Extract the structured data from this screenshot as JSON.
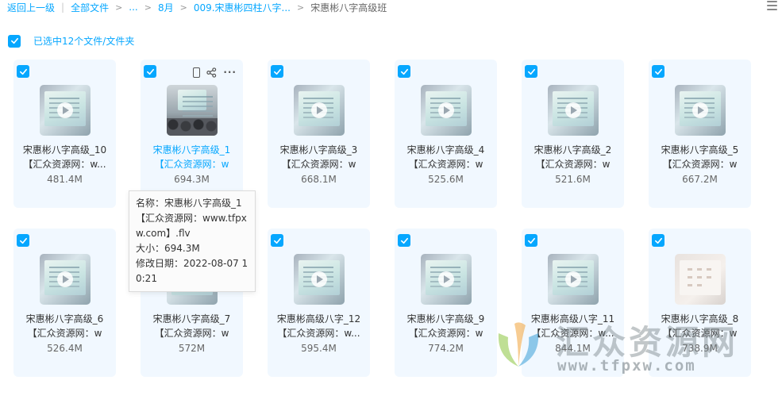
{
  "breadcrumb": {
    "back": "返回上一级",
    "all_files": "全部文件",
    "ellipsis": "...",
    "month": "8月",
    "folder": "009.宋惠彬四柱八字...",
    "current": "宋惠彬八字高级班"
  },
  "selection": {
    "label": "已选中12个文件/文件夹"
  },
  "accent_color": "#06a7ff",
  "files": [
    {
      "name1": "宋惠彬八字高级_10",
      "name2": "【汇众资源网：w...",
      "size": "481.4M",
      "thumb": "video-thumb"
    },
    {
      "name1": "宋惠彬八字高级_1",
      "name2": "【汇众资源网：w",
      "size": "694.3M",
      "thumb": "video-thumb-crowd"
    },
    {
      "name1": "宋惠彬八字高级_3",
      "name2": "【汇众资源网：w",
      "size": "668.1M",
      "thumb": "video-thumb"
    },
    {
      "name1": "宋惠彬八字高级_4",
      "name2": "【汇众资源网：w",
      "size": "525.6M",
      "thumb": "video-thumb"
    },
    {
      "name1": "宋惠彬八字高级_2",
      "name2": "【汇众资源网：w",
      "size": "521.6M",
      "thumb": "video-thumb"
    },
    {
      "name1": "宋惠彬八字高级_5",
      "name2": "【汇众资源网：w",
      "size": "667.2M",
      "thumb": "video-thumb"
    },
    {
      "name1": "宋惠彬八字高级_6",
      "name2": "【汇众资源网：w",
      "size": "526.4M",
      "thumb": "video-thumb"
    },
    {
      "name1": "宋惠彬八字高级_7",
      "name2": "【汇众资源网：w",
      "size": "572M",
      "thumb": "video-thumb"
    },
    {
      "name1": "宋惠彬高级八字_12",
      "name2": "【汇众资源网：w...",
      "size": "595.4M",
      "thumb": "video-thumb"
    },
    {
      "name1": "宋惠彬八字高级_9",
      "name2": "【汇众资源网：w",
      "size": "774.2M",
      "thumb": "video-thumb"
    },
    {
      "name1": "宋惠彬高级八字_11",
      "name2": "【汇众资源网：w...",
      "size": "844.1M",
      "thumb": "video-thumb"
    },
    {
      "name1": "宋惠彬八字高级_8",
      "name2": "【汇众资源网：w",
      "size": "738.9M",
      "thumb": "video-thumb-white"
    }
  ],
  "tooltip": {
    "line1": "名称：宋惠彬八字高级_1",
    "line2": "【汇众资源网：www.tfpx",
    "line3": "w.com】.flv",
    "line4": "大小：694.3M",
    "line5": "修改日期：2022-08-07 1",
    "line6": "0:21"
  },
  "watermark": {
    "title": "汇众资源网",
    "url": "www.tfpxw.com"
  }
}
